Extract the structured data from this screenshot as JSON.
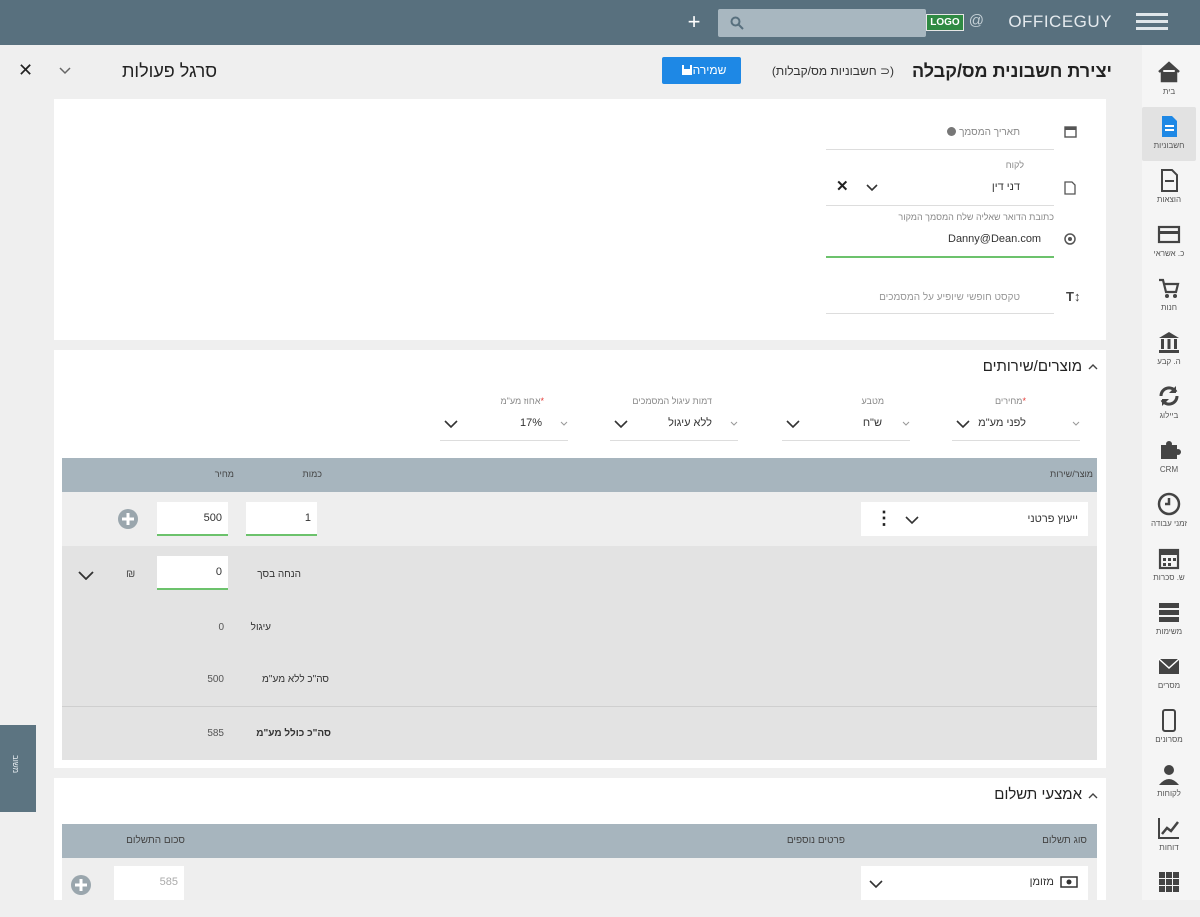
{
  "topbar": {
    "brand": "OFFICEGUY",
    "brand_at": "@",
    "brand_logo": "LOGO"
  },
  "sidebar": {
    "items": [
      {
        "label": "בית",
        "icon": "home-icon"
      },
      {
        "label": "חשבוניות",
        "icon": "document-icon",
        "active": true
      },
      {
        "label": "הוצאות",
        "icon": "expense-icon"
      },
      {
        "label": "כ. אשראי",
        "icon": "credit-card-icon"
      },
      {
        "label": "חנות",
        "icon": "cart-icon"
      },
      {
        "label": "ה. קבע",
        "icon": "bank-icon"
      },
      {
        "label": "ביילוג",
        "icon": "sync-icon"
      },
      {
        "label": "CRM",
        "icon": "puzzle-icon"
      },
      {
        "label": "זמני עבודה",
        "icon": "clock-icon"
      },
      {
        "label": "ש. סכרות",
        "icon": "calendar-icon"
      },
      {
        "label": "משימות",
        "icon": "list-icon"
      },
      {
        "label": "מסרים",
        "icon": "mail-icon"
      },
      {
        "label": "מסרונים",
        "icon": "phone-icon"
      },
      {
        "label": "לקוחות",
        "icon": "user-icon"
      },
      {
        "label": "דוחות",
        "icon": "chart-icon"
      },
      {
        "label": "",
        "icon": "grid-icon"
      }
    ]
  },
  "titlebar": {
    "title": "יצירת חשבונית מס/קבלה",
    "crumb": "(⊂ חשבוניות מס/קבלות)",
    "save": "שמירה"
  },
  "actions": {
    "title": "סרגל פעולות"
  },
  "details": {
    "doc_date_label": "תאריך המסמך",
    "customer_label": "לקוח",
    "customer_value": "דני דין",
    "email_label": "כתובת הדואר שאליה שלח המסמך המקור",
    "email_value": "Danny@Dean.com",
    "free_text_placeholder": "טקסט חופשי שיופיע על המסמכים"
  },
  "products": {
    "section_title": "מוצרים/שירותים",
    "prices_label": "מחירים",
    "prices_value": "לפני מע\"מ",
    "currency_label": "מטבע",
    "currency_value": "ש\"ח",
    "rounding_label": "דמות עיגול המסמכים",
    "rounding_value": "ללא עיגול",
    "vat_label": "אחוז מע\"מ",
    "vat_value": "17%",
    "col_product": "מוצר/שירות",
    "col_qty": "כמות",
    "col_price": "מחיר",
    "row_product": "ייעוץ פרטני",
    "row_qty": "1",
    "row_price": "500",
    "discount_label": "הנחה בסך",
    "discount_value": "0",
    "discount_unit": "₪",
    "rounding_sum_label": "עיגול",
    "rounding_sum_value": "0",
    "subtotal_label": "סה\"כ ללא מע\"מ",
    "subtotal_value": "500",
    "total_label": "סה\"כ כולל מע\"מ",
    "total_value": "585"
  },
  "payments": {
    "section_title": "אמצעי תשלום",
    "col_type": "סוג תשלום",
    "col_details": "פרטים נוספים",
    "col_amount": "סכום התשלום",
    "row_type": "מזומן",
    "row_amount": "585"
  },
  "float_tab": {
    "label": "משוב"
  },
  "colors": {
    "topbar": "#58707e",
    "accent": "#1e88e5",
    "table_header": "#a7b5be",
    "valid_underline": "#6cc26c"
  }
}
